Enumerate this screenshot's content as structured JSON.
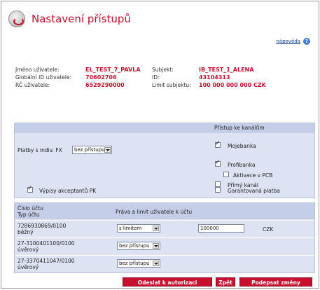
{
  "header": {
    "title": "Nastavení přístupů",
    "help_link": "nápověda",
    "logo_icon": "logo-icon",
    "help_icon": "question-icon"
  },
  "user_info": {
    "username_label": "Jméno uživatele:",
    "username_value": "EL_TEST_7_PAVLA",
    "global_id_label": "Globální ID uživatele:",
    "global_id_value": "70602706",
    "rc_label": "RČ uživatele:",
    "rc_value": "6529290000",
    "subject_label": "Subjekt:",
    "subject_value": "IB_TEST_1_ALENA",
    "id_label": "ID:",
    "id_value": "43104313",
    "limit_label": "Limit subjektu:",
    "limit_value": "100 000 000 000 CZK"
  },
  "channels": {
    "header": "Přístup ke kanálům",
    "fx_label": "Platby s indiv. FX",
    "fx_select": "bez přístupu",
    "items": [
      {
        "label": "Mojebanka",
        "checked": true
      },
      {
        "label": "Profibanka",
        "checked": true
      },
      {
        "label": "Aktivace v PCB",
        "checked": false
      },
      {
        "label": "Přímý kanál",
        "checked": false
      },
      {
        "label": "Garantovaná platba",
        "checked": false
      }
    ],
    "statements_label": "Výpisy akceptantů PK",
    "statements_checked": true
  },
  "accounts": {
    "col_account": "Číslo účtu",
    "col_type": "Typ účtu",
    "col_rights": "Práva a limit uživatele k účtu",
    "rows": [
      {
        "number": "7286930869/0100",
        "type": "běžný",
        "right": "s limitem",
        "limit": "100000",
        "currency": "CZK"
      },
      {
        "number": "27-3100401100/0100",
        "type": "úvěrový",
        "right": "bez přístupu"
      },
      {
        "number": "27-3370411047/0100",
        "type": "úvěrový",
        "right": "bez přístupu"
      }
    ]
  },
  "buttons": {
    "send": "Odeslat k autorizaci",
    "back": "Zpět",
    "sign": "Podepsat změny"
  },
  "colors": {
    "accent": "#c8102e",
    "panel": "#dde3f2",
    "panel_head": "#c5cee9"
  }
}
